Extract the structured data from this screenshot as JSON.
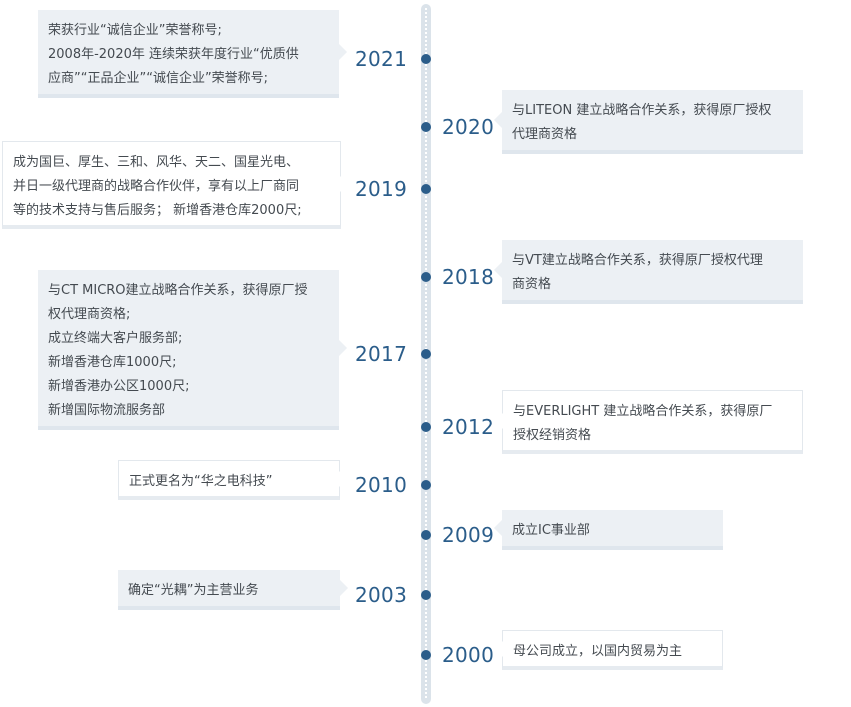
{
  "timeline": {
    "events": [
      {
        "year": "2021",
        "lines": [
          "荣获行业“诚信企业”荣誉称号;",
          "2008年-2020年  连续荣获年度行业“优质供",
          "应商”“正品企业”“诚信企业”荣誉称号;"
        ]
      },
      {
        "year": "2020",
        "lines": [
          "与LITEON 建立战略合作关系，获得原厂授权",
          "代理商资格"
        ]
      },
      {
        "year": "2019",
        "lines": [
          "成为国巨、厚生、三和、风华、天二、国星光电、",
          "并日一级代理商的战略合作伙伴，享有以上厂商同",
          "等的技术支持与售后服务；  新增香港仓库2000尺;"
        ]
      },
      {
        "year": "2018",
        "lines": [
          "与VT建立战略合作关系，获得原厂授权代理",
          "商资格"
        ]
      },
      {
        "year": "2017",
        "lines": [
          "与CT MICRO建立战略合作关系，获得原厂授",
          "权代理商资格;",
          "成立终端大客户服务部;",
          "新增香港仓库1000尺;",
          "新增香港办公区1000尺;",
          "新增国际物流服务部"
        ]
      },
      {
        "year": "2012",
        "lines": [
          "与EVERLIGHT 建立战略合作关系，获得原厂",
          "授权经销资格"
        ]
      },
      {
        "year": "2010",
        "lines": [
          "正式更名为“华之电科技”"
        ]
      },
      {
        "year": "2009",
        "lines": [
          "成立IC事业部"
        ]
      },
      {
        "year": "2003",
        "lines": [
          "确定“光耦”为主营业务"
        ]
      },
      {
        "year": "2000",
        "lines": [
          "母公司成立，以国内贸易为主"
        ]
      }
    ]
  }
}
